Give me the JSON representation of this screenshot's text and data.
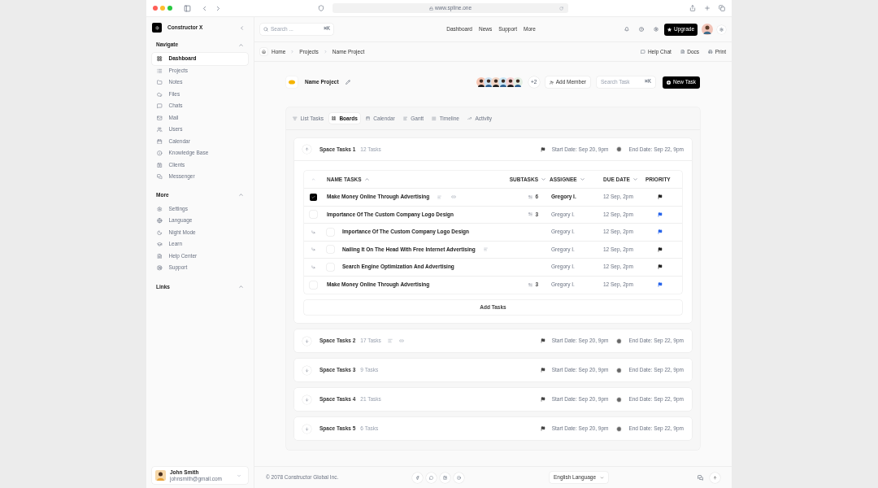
{
  "browser": {
    "url": "www.spline.one"
  },
  "sidebar": {
    "brand": "Constructor X",
    "sections": [
      {
        "title": "Navigate",
        "expanded": true,
        "items": [
          {
            "label": "Dashboard",
            "selected": true
          },
          {
            "label": "Projects",
            "selected": false
          },
          {
            "label": "Notes",
            "selected": false
          },
          {
            "label": "Files",
            "selected": false
          },
          {
            "label": "Chats",
            "selected": false
          },
          {
            "label": "Mail",
            "selected": false
          },
          {
            "label": "Users",
            "selected": false
          },
          {
            "label": "Calendar",
            "selected": false
          },
          {
            "label": "Knowledge Base",
            "selected": false
          },
          {
            "label": "Clients",
            "selected": false
          },
          {
            "label": "Messenger",
            "selected": false
          }
        ]
      },
      {
        "title": "More",
        "expanded": true,
        "items": [
          {
            "label": "Settings",
            "selected": false
          },
          {
            "label": "Language",
            "selected": false
          },
          {
            "label": "Night Mode",
            "selected": false
          },
          {
            "label": "Learn",
            "selected": false
          },
          {
            "label": "Help Center",
            "selected": false
          },
          {
            "label": "Support",
            "selected": false
          }
        ]
      },
      {
        "title": "Links",
        "expanded": true
      }
    ],
    "user": {
      "name": "John Smith",
      "email": "johnsmith@gmail.com"
    }
  },
  "topbar": {
    "search": {
      "placeholder": "Search ...",
      "shortcut": "⌘K"
    },
    "nav": [
      "Dashboard",
      "News",
      "Support",
      "More"
    ],
    "upgrade": "Upgrade"
  },
  "breadcrumb": {
    "items": [
      "Home",
      "Projects",
      "Name Project"
    ],
    "actions": [
      "Help Chat",
      "Docs",
      "Print"
    ]
  },
  "project": {
    "title": "Name Project",
    "extra_members": "+2",
    "add_member": "Add Member",
    "search": {
      "placeholder": "Search Task",
      "shortcut": "⌘K"
    },
    "new_task": "New Task"
  },
  "tabs": [
    {
      "label": "List Tasks",
      "selected": false
    },
    {
      "label": "Boards",
      "selected": true
    },
    {
      "label": "Calendar",
      "selected": false
    },
    {
      "label": "Gantt",
      "selected": false
    },
    {
      "label": "Timeline",
      "selected": false
    },
    {
      "label": "Activity",
      "selected": false
    }
  ],
  "spaces": [
    {
      "title": "Space Tasks 1",
      "count": "12 Tasks",
      "expanded": true,
      "notes": false,
      "links": false,
      "start": "Start Date: Sep 20, 9pm",
      "end": "End Date: Sep 22, 9pm"
    },
    {
      "title": "Space Tasks 2",
      "count": "17 Tasks",
      "expanded": false,
      "notes": true,
      "links": true,
      "start": "Start Date: Sep 20, 9pm",
      "end": "End Date: Sep 22, 9pm"
    },
    {
      "title": "Space Tasks 3",
      "count": "9 Tasks",
      "expanded": false,
      "notes": false,
      "links": false,
      "start": "Start Date: Sep 20, 9pm",
      "end": "End Date: Sep 22, 9pm"
    },
    {
      "title": "Space Tasks 4",
      "count": "21 Tasks",
      "expanded": false,
      "notes": false,
      "links": false,
      "start": "Start Date: Sep 20, 9pm",
      "end": "End Date: Sep 22, 9pm"
    },
    {
      "title": "Space Tasks 5",
      "count": "6 Tasks",
      "expanded": false,
      "notes": false,
      "links": false,
      "start": "Start Date: Sep 20, 9pm",
      "end": "End Date: Sep 22, 9pm"
    }
  ],
  "table": {
    "columns": [
      {
        "label": "NAME TASKS",
        "sort_arrow": true,
        "ascending": true
      },
      {
        "label": "SUBTASKS",
        "sort_arrow": true,
        "ascending": false
      },
      {
        "label": "ASSIGNEE",
        "sort_arrow": true,
        "ascending": false
      },
      {
        "label": "DUE DATE",
        "sort_arrow": true,
        "ascending": false
      },
      {
        "label": "PRIORITY",
        "sort_arrow": false
      }
    ],
    "rows": [
      {
        "title": "Make Money Online Through Advertising",
        "checked": true,
        "subtask": false,
        "notes": true,
        "links": true,
        "subtasks": "6",
        "assignee": "Gregory I.",
        "due": "12 Sep, 2pm",
        "color": "#222222"
      },
      {
        "title": "Importance Of The Custom Company Logo Design",
        "checked": false,
        "subtask": false,
        "notes": false,
        "links": false,
        "subtasks": "3",
        "assignee": "Gregory I.",
        "due": "12 Sep, 2pm",
        "color": "#2563eb"
      },
      {
        "title": "Importance Of The Custom Company Logo Design",
        "checked": false,
        "subtask": true,
        "notes": false,
        "links": false,
        "assignee": "Gregory I.",
        "due": "12 Sep, 2pm",
        "color": "#2563eb"
      },
      {
        "title": "Nailing It On The Head With Free Internet Advertising",
        "checked": false,
        "subtask": true,
        "notes": true,
        "links": false,
        "assignee": "Gregory I.",
        "due": "12 Sep, 2pm",
        "color": "#222222"
      },
      {
        "title": "Search Engine Optimization And Advertising",
        "checked": false,
        "subtask": true,
        "notes": false,
        "links": false,
        "assignee": "Gregory I.",
        "due": "12 Sep, 2pm",
        "color": "#222222"
      },
      {
        "title": "Make Money Online Through Advertising",
        "checked": false,
        "subtask": false,
        "notes": false,
        "links": false,
        "subtasks": "3",
        "assignee": "Gregory I.",
        "due": "12 Sep, 2pm",
        "color": "#2563eb"
      }
    ],
    "add_tasks": "Add Tasks"
  },
  "footer": {
    "copyright": "© 2078 Constructor Global Inc.",
    "language": "English Language"
  }
}
